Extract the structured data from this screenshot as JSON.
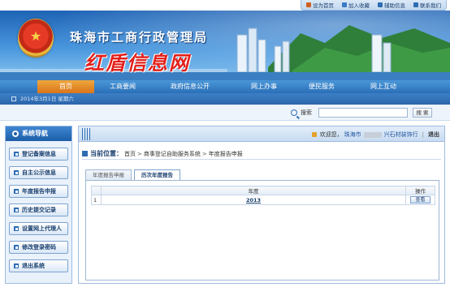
{
  "top_links": [
    {
      "label": "设为首页",
      "icon": "home-icon",
      "color": "#d06020"
    },
    {
      "label": "加入收藏",
      "icon": "star-icon",
      "color": "#3a7ac8"
    },
    {
      "label": "辅助信息",
      "icon": "info-icon",
      "color": "#2d6db3"
    },
    {
      "label": "联系我们",
      "icon": "contact-icon",
      "color": "#2d6db3"
    }
  ],
  "banner": {
    "title": "珠海市工商行政管理局",
    "slogan": "红盾信息网"
  },
  "main_nav": [
    {
      "label": "首页",
      "active": true
    },
    {
      "label": "工商要闻",
      "active": false
    },
    {
      "label": "政府信息公开",
      "active": false
    },
    {
      "label": "网上办事",
      "active": false
    },
    {
      "label": "便民服务",
      "active": false
    },
    {
      "label": "网上互动",
      "active": false
    }
  ],
  "date_text": "2014年3月1日  星期六",
  "search": {
    "label": "搜索",
    "value": "",
    "button": "搜 索"
  },
  "sidebar": {
    "title": "系统导航",
    "items": [
      "登记备案信息",
      "自主公示信息",
      "年度报告申报",
      "历史提交记录",
      "设置网上代理人",
      "修改登录密码",
      "退出系统"
    ]
  },
  "header": {
    "welcome_prefix": "欢迎您，",
    "user_left": "珠海市",
    "user_right": "兴石材装饰行",
    "separator": "|",
    "logout": "退出"
  },
  "breadcrumb": {
    "label": "当前位置：",
    "items": [
      "首页",
      "商事登记自助服务系统",
      "年度报告申报"
    ],
    "separator": ">"
  },
  "tabs": [
    {
      "label": "年度报告申报",
      "active": false
    },
    {
      "label": "历次年度报告",
      "active": true
    }
  ],
  "table": {
    "columns": [
      "",
      "年度",
      "操作"
    ],
    "rows": [
      {
        "index": "1",
        "year": "2013",
        "action": "查看"
      }
    ]
  },
  "colors": {
    "nav_active": "#e68a2a",
    "nav_bg": "#2a6fb8",
    "accent": "#1a3f6f"
  }
}
